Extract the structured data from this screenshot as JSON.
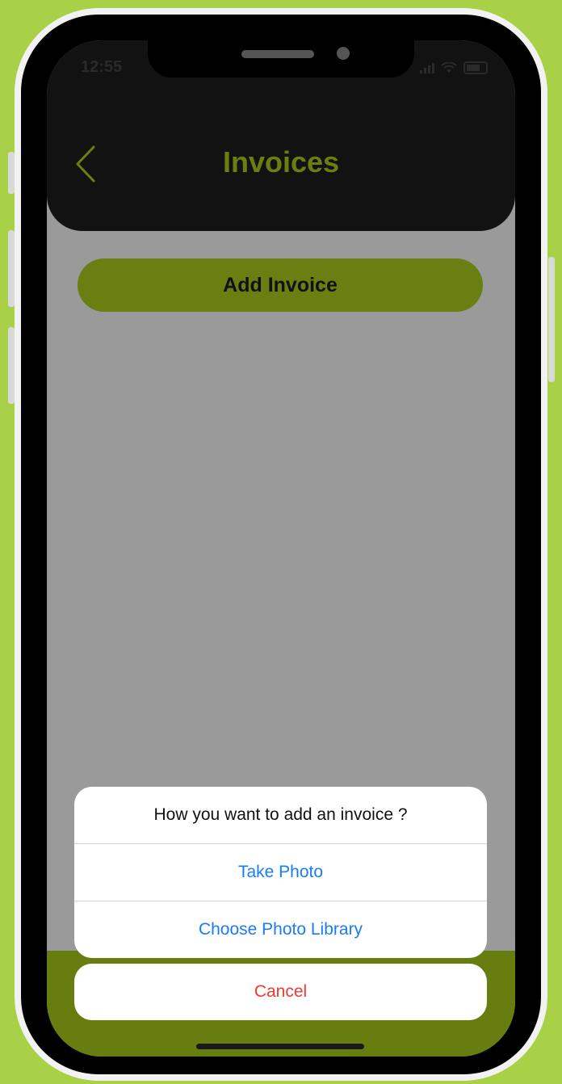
{
  "status_bar": {
    "time": "12:55"
  },
  "header": {
    "title": "Invoices",
    "back_icon": "chevron-left-icon"
  },
  "main": {
    "add_invoice_label": "Add Invoice"
  },
  "action_sheet": {
    "title": "How you want to add an invoice ?",
    "options": [
      "Take Photo",
      "Choose Photo Library"
    ],
    "cancel_label": "Cancel"
  },
  "colors": {
    "background": "#a8d147",
    "accent": "#697f11",
    "title_color": "#6a7f10",
    "ios_blue": "#1a7cf5",
    "ios_red": "#f23a30"
  }
}
